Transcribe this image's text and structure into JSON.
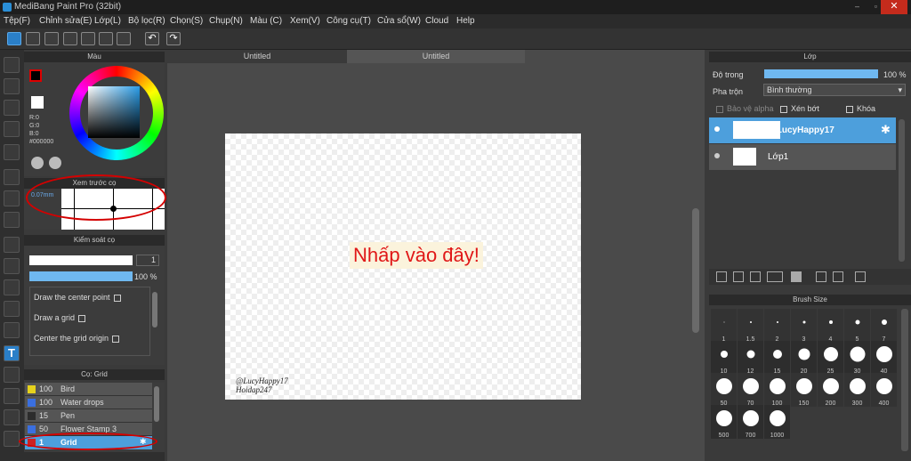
{
  "app": {
    "title": "MediBang Paint Pro (32bit)"
  },
  "menu": [
    "Tệp(F)",
    "Chỉnh sửa(E)",
    "Lớp(L)",
    "Bộ lọc(R)",
    "Chọn(S)",
    "Chụp(N)",
    "Màu (C)",
    "Xem(V)",
    "Công cụ(T)",
    "Cửa sổ(W)",
    "Cloud",
    "Help"
  ],
  "color_panel": {
    "title": "Màu",
    "r": "R:0",
    "g": "G:0",
    "b": "B:0",
    "hex": "#000000"
  },
  "brush_preview": {
    "title": "Xem trước cọ",
    "size": "0.07mm"
  },
  "brush_control": {
    "title": "Kiểm soát cọ",
    "size_value": "1",
    "opacity_value": "100 %",
    "options": [
      "Draw the center point",
      "Draw a grid",
      "Center the grid origin"
    ]
  },
  "brush_list": {
    "title": "Cọ: Grid",
    "items": [
      {
        "size": "100",
        "name": "Bird",
        "color": "#e6d21c"
      },
      {
        "size": "100",
        "name": "Water drops",
        "color": "#3a6fe0"
      },
      {
        "size": "15",
        "name": "Pen",
        "color": "#2c2c2c"
      },
      {
        "size": "50",
        "name": "Flower Stamp 3",
        "color": "#3a6fe0"
      },
      {
        "size": "1",
        "name": "Grid",
        "color": "#cc2222"
      }
    ]
  },
  "tabs": [
    "Untitled",
    "Untitled"
  ],
  "canvas": {
    "hint": "Nhấp vào đây!",
    "watermark1": "@LucyHappy17",
    "watermark2": "Hoidap247"
  },
  "layer_panel": {
    "title": "Lớp",
    "opacity_label": "Độ trong",
    "opacity_value": "100 %",
    "blend_label": "Pha trộn",
    "blend_value": "Bình thường",
    "alpha": "Bảo vệ alpha",
    "clip": "Xén bớt",
    "lock": "Khóa",
    "layers": [
      {
        "name": "@LucyHappy17"
      },
      {
        "name": "Lớp1"
      }
    ]
  },
  "brush_size": {
    "title": "Brush Size",
    "sizes": [
      "1",
      "1.5",
      "2",
      "3",
      "4",
      "5",
      "7",
      "10",
      "12",
      "15",
      "20",
      "25",
      "30",
      "40",
      "50",
      "70",
      "100",
      "150",
      "200",
      "300",
      "400",
      "500",
      "700",
      "1000"
    ]
  }
}
